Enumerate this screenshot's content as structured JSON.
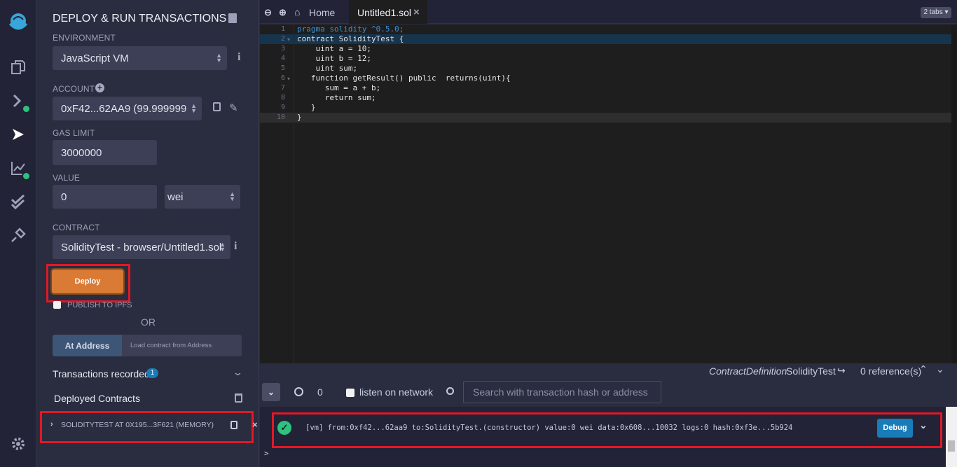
{
  "panel": {
    "title": "DEPLOY & RUN TRANSACTIONS",
    "environment_label": "ENVIRONMENT",
    "environment_value": "JavaScript VM",
    "account_label": "ACCOUNT",
    "account_value": "0xF42...62AA9 (99.999999",
    "gas_limit_label": "GAS LIMIT",
    "gas_limit_value": "3000000",
    "value_label": "VALUE",
    "value_amount": "0",
    "value_unit": "wei",
    "contract_label": "CONTRACT",
    "contract_value": "SolidityTest - browser/Untitled1.sol",
    "deploy_label": "Deploy",
    "publish_label": "PUBLISH TO IPFS",
    "or_label": "OR",
    "at_address_label": "At Address",
    "at_address_placeholder": "Load contract from Address",
    "transactions_label": "Transactions recorded",
    "transactions_count": "1",
    "deployed_label": "Deployed Contracts",
    "deployed_instance": "SOLIDITYTEST AT 0X195...3F621 (MEMORY)"
  },
  "tabs": {
    "home_label": "Home",
    "file_label": "Untitled1.sol",
    "count_label": "2 tabs"
  },
  "editor": {
    "lines": [
      {
        "n": "1",
        "text": "pragma solidity ^0.5.0;"
      },
      {
        "n": "2",
        "text": "contract SolidityTest {"
      },
      {
        "n": "3",
        "text": "    uint a = 10;"
      },
      {
        "n": "4",
        "text": "    uint b = 12;"
      },
      {
        "n": "5",
        "text": "    uint sum;"
      },
      {
        "n": "6",
        "text": "   function getResult() public  returns(uint){"
      },
      {
        "n": "7",
        "text": "      sum = a + b;"
      },
      {
        "n": "8",
        "text": "      return sum;"
      },
      {
        "n": "9",
        "text": "   }"
      },
      {
        "n": "10",
        "text": "}"
      }
    ]
  },
  "status": {
    "definition_type": "ContractDefinition",
    "definition_name": "SolidityTest",
    "references": "0 reference(s)"
  },
  "terminal": {
    "counter": "0",
    "listen_label": "listen on network",
    "search_placeholder": "Search with transaction hash or address",
    "log_line": "[vm]  from:0xf42...62aa9 to:SolidityTest.(constructor) value:0 wei data:0x608...10032 logs:0 hash:0xf3e...5b924",
    "debug_label": "Debug",
    "prompt": ">"
  },
  "colors": {
    "deploy": "#d97b35",
    "accent_blue": "#1a7bb9",
    "success": "#2ec27e",
    "highlight": "#e21825"
  }
}
